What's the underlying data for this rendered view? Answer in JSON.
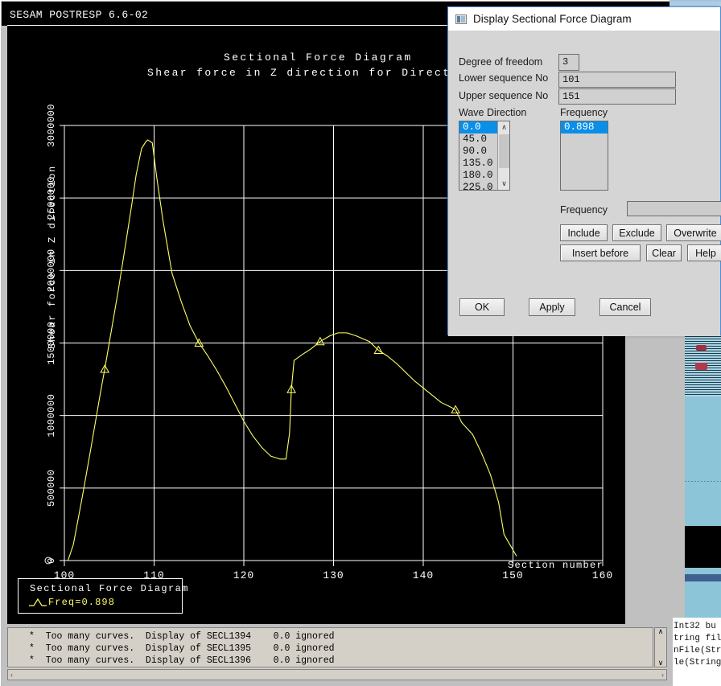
{
  "background": {
    "other_window_titlebar": "",
    "code_lines": [
      "Int32 bu",
      "",
      "tring fil",
      "nFile(Str",
      "le(String"
    ]
  },
  "main_window": {
    "title": "SESAM POSTRESP 6.6-02"
  },
  "chart_data": {
    "type": "line",
    "title": "Sectional Force Diagram",
    "subtitle": "Shear force in Z direction for Directio",
    "xlabel": "Section number",
    "ylabel": "Shear force in Z direction",
    "xlim": [
      100,
      160
    ],
    "ylim": [
      0,
      3000000
    ],
    "xticks": [
      100,
      110,
      120,
      130,
      140,
      150,
      160
    ],
    "xtick_labels": [
      "100",
      "110",
      "120",
      "130",
      "140",
      "150",
      "160"
    ],
    "yticks": [
      0,
      500000,
      1000000,
      1500000,
      2000000,
      2500000,
      3000000
    ],
    "ytick_labels": [
      "0",
      "500000",
      "1000000",
      "1500000",
      "2000000",
      "2500000",
      "3000000"
    ],
    "grid": true,
    "legend_position": "bottom-left",
    "series": [
      {
        "name": "Freq=0.898",
        "color": "#ffff66",
        "marker": "triangle",
        "x": [
          100.4,
          101.0,
          102.0,
          103.0,
          104.0,
          104.5,
          105.0,
          106.0,
          107.0,
          107.5,
          108.0,
          108.6,
          109.1,
          109.3,
          109.8,
          110.3,
          111.0,
          112.0,
          113.0,
          114.0,
          115.0,
          116.0,
          117.0,
          118.0,
          119.0,
          120.0,
          121.0,
          122.0,
          123.0,
          124.0,
          124.7,
          125.1,
          125.3,
          125.6,
          126.5,
          127.5,
          128.5,
          129.6,
          130.5,
          131.5,
          132.5,
          134.0,
          135.0,
          136.0,
          137.0,
          138.0,
          139.0,
          140.0,
          141.0,
          142.0,
          143.0,
          143.6,
          144.3,
          145.5,
          146.5,
          147.5,
          148.4,
          149.0,
          150.4
        ],
        "y": [
          0,
          110000,
          440000,
          790000,
          1150000,
          1320000,
          1500000,
          1860000,
          2250000,
          2450000,
          2660000,
          2840000,
          2890000,
          2900000,
          2880000,
          2640000,
          2340000,
          1980000,
          1790000,
          1620000,
          1500000,
          1410000,
          1310000,
          1200000,
          1080000,
          960000,
          860000,
          780000,
          720000,
          700000,
          700000,
          880000,
          1180000,
          1380000,
          1420000,
          1460000,
          1510000,
          1550000,
          1570000,
          1570000,
          1550000,
          1510000,
          1450000,
          1410000,
          1360000,
          1300000,
          1240000,
          1190000,
          1140000,
          1090000,
          1060000,
          1040000,
          950000,
          870000,
          740000,
          590000,
          400000,
          180000,
          30000,
          20000
        ]
      }
    ],
    "markers_at_x": [
      104.5,
      115.0,
      125.3,
      128.5,
      135.0,
      143.6
    ],
    "legend": {
      "header": "Sectional Force Diagram",
      "entry": "Freq=0.898"
    }
  },
  "console": {
    "lines": [
      "*  Too many curves.  Display of SECL1394    0.0 ignored",
      "*  Too many curves.  Display of SECL1395    0.0 ignored",
      "*  Too many curves.  Display of SECL1396    0.0 ignored"
    ],
    "scroll_up": "∧",
    "scroll_down": "∨",
    "scroll_left": "‹",
    "scroll_right": "›"
  },
  "dialog": {
    "title": "Display Sectional Force Diagram",
    "fields": {
      "dof_label": "Degree of freedom",
      "dof_value": "3",
      "lower_seq_label": "Lower sequence No",
      "lower_seq_value": "101",
      "upper_seq_label": "Upper sequence No",
      "upper_seq_value": "151"
    },
    "wave_direction": {
      "label": "Wave Direction",
      "options": [
        "0.0",
        "45.0",
        "90.0",
        "135.0",
        "180.0",
        "225.0"
      ],
      "selected": "0.0",
      "scroll_up": "∧",
      "scroll_down": "∨"
    },
    "frequency_list": {
      "label": "Frequency",
      "options": [
        "0.898"
      ],
      "selected": "0.898"
    },
    "frequency_input": {
      "label": "Frequency",
      "value": ""
    },
    "buttons": {
      "include": "Include",
      "exclude": "Exclude",
      "overwrite": "Overwrite",
      "insert_before": "Insert before",
      "clear": "Clear",
      "help": "Help",
      "ok": "OK",
      "apply": "Apply",
      "cancel": "Cancel"
    }
  },
  "colors": {
    "curve": "#ffff66",
    "canvas_bg": "#000000",
    "grid": "#ffffff",
    "selection": "#0a8fe8",
    "dialog_bg": "#d5d5d5"
  }
}
